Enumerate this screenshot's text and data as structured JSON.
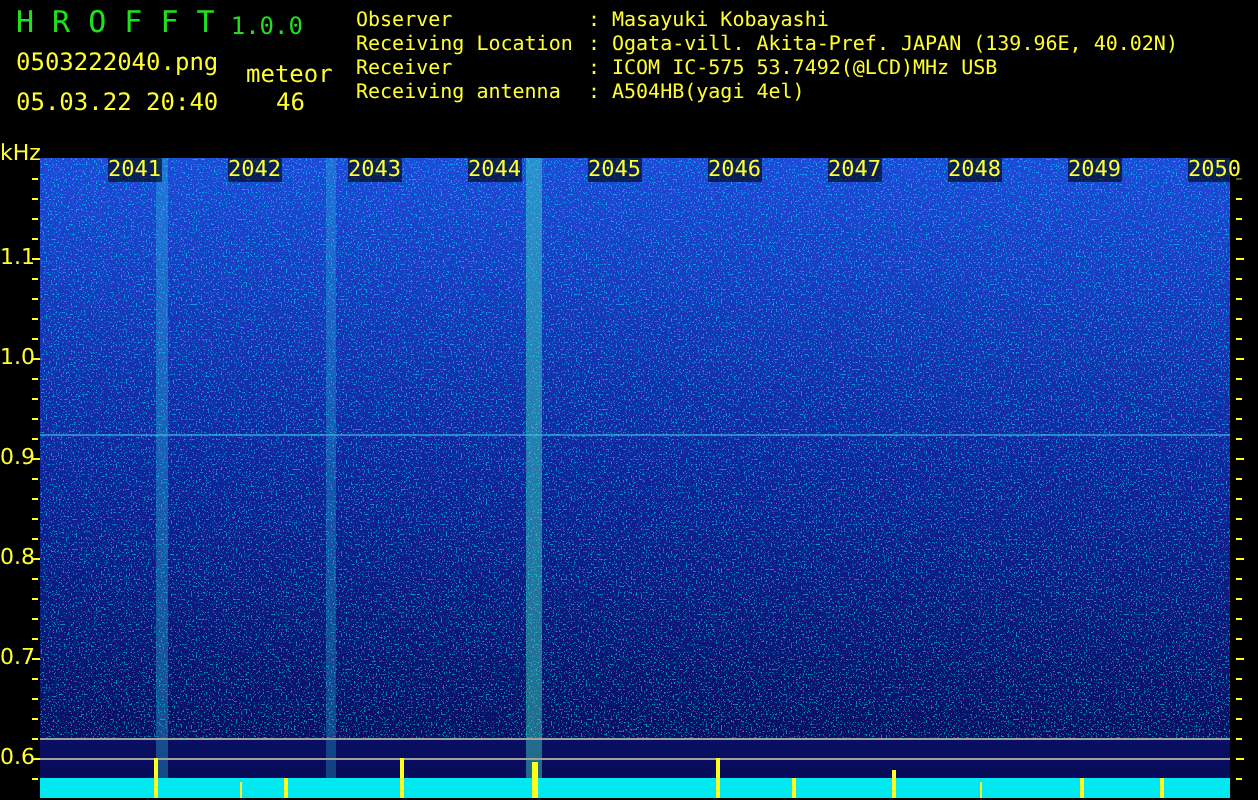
{
  "header": {
    "app_title": "H R O F F T",
    "version": "1.0.0",
    "filename": "0503222040.png",
    "datetime": "05.03.22 20:40",
    "meteor_label": "meteor",
    "meteor_count": "46"
  },
  "info": [
    {
      "label": "Observer",
      "value": "Masayuki Kobayashi"
    },
    {
      "label": "Receiving Location",
      "value": "Ogata-vill. Akita-Pref. JAPAN (139.96E, 40.02N)"
    },
    {
      "label": "Receiver",
      "value": "ICOM IC-575 53.7492(@LCD)MHz USB"
    },
    {
      "label": "Receiving antenna",
      "value": "A504HB(yagi 4el)"
    }
  ],
  "separator": ":",
  "axis": {
    "unit": "kHz",
    "y_ticks": [
      "1.1",
      "1.0",
      "0.9",
      "0.8",
      "0.7",
      "0.6"
    ]
  },
  "time_labels": [
    "2041",
    "2042",
    "2043",
    "2044",
    "2045",
    "2046",
    "2047",
    "2048",
    "2049",
    "2050"
  ]
}
